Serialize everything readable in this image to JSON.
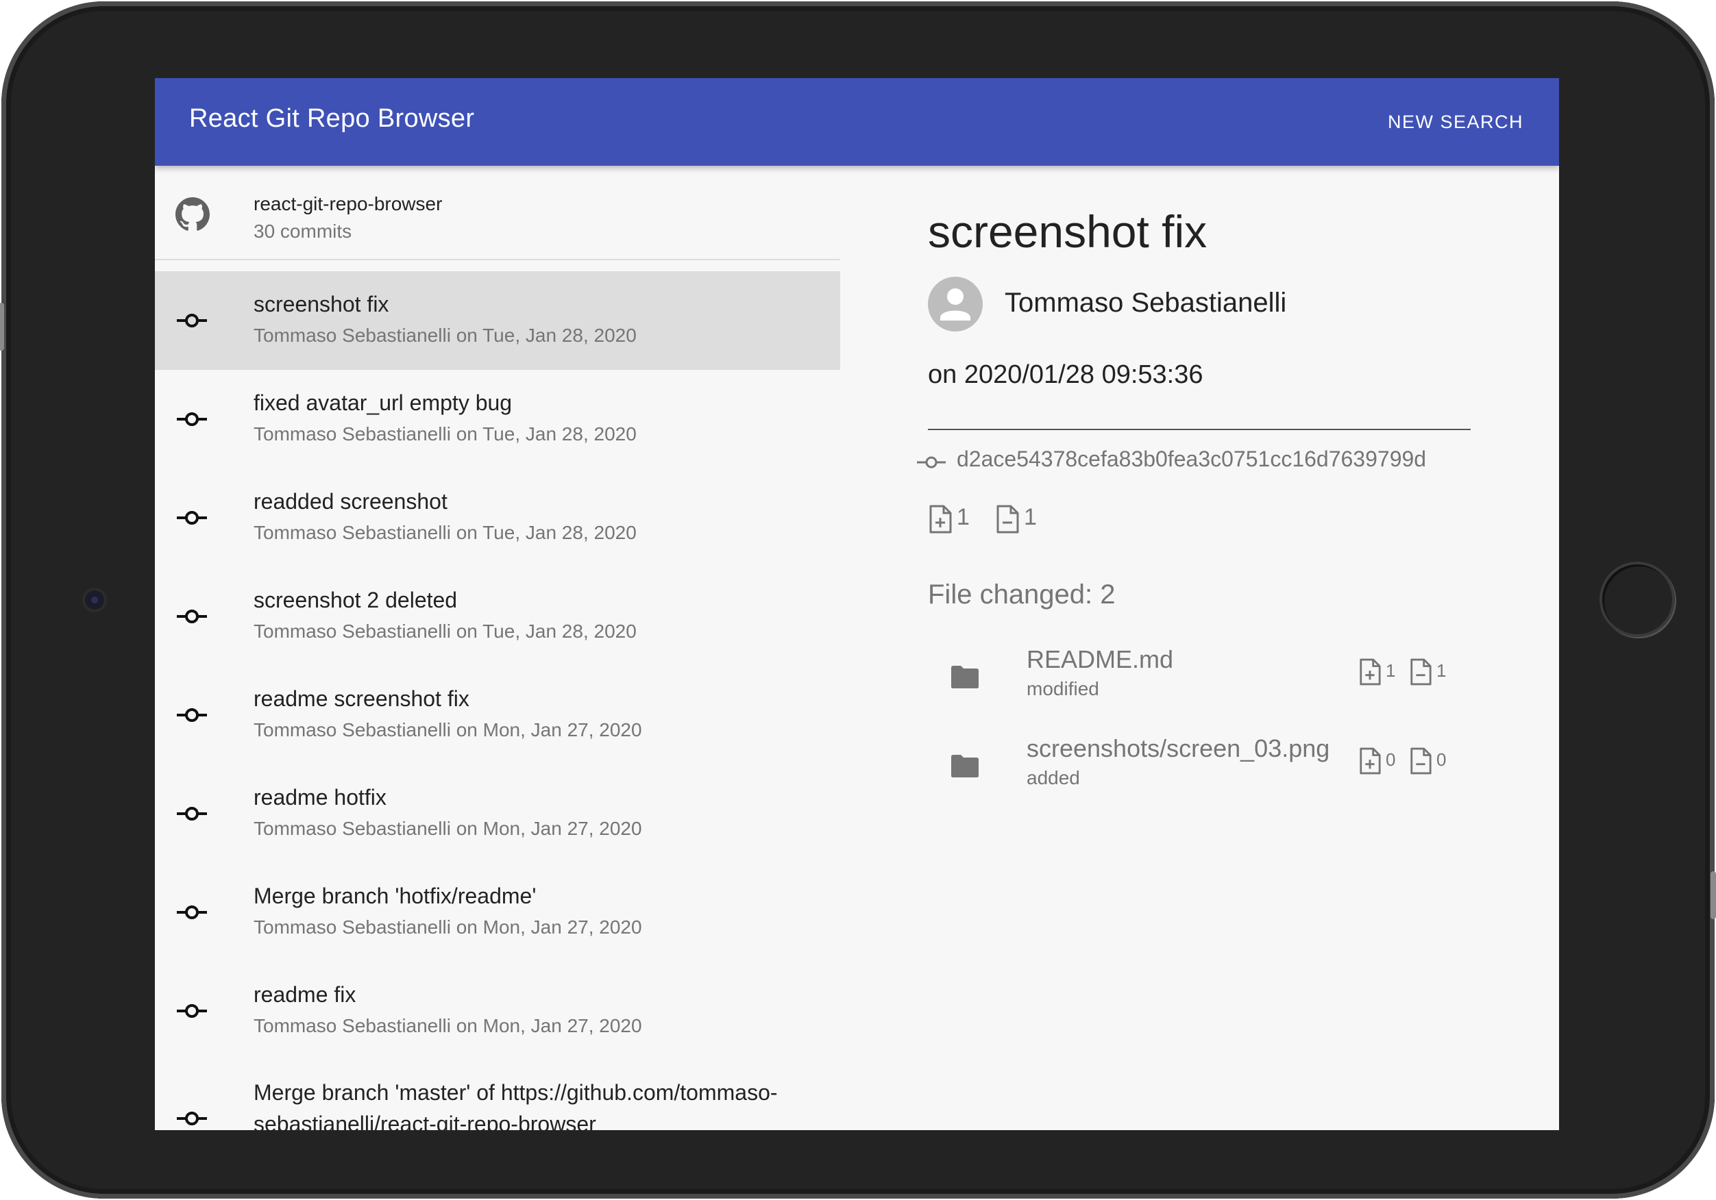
{
  "app": {
    "title": "React Git Repo Browser",
    "new_search_label": "NEW SEARCH"
  },
  "repo": {
    "name": "react-git-repo-browser",
    "commit_count": "30 commits",
    "icon": "github-icon"
  },
  "commits": [
    {
      "message": "screenshot fix",
      "meta": "Tommaso Sebastianelli on Tue, Jan 28, 2020",
      "selected": true
    },
    {
      "message": "fixed avatar_url empty bug",
      "meta": "Tommaso Sebastianelli on Tue, Jan 28, 2020"
    },
    {
      "message": "readded screenshot",
      "meta": "Tommaso Sebastianelli on Tue, Jan 28, 2020"
    },
    {
      "message": "screenshot 2 deleted",
      "meta": "Tommaso Sebastianelli on Tue, Jan 28, 2020"
    },
    {
      "message": "readme screenshot fix",
      "meta": "Tommaso Sebastianelli on Mon, Jan 27, 2020"
    },
    {
      "message": "readme hotfix",
      "meta": "Tommaso Sebastianelli on Mon, Jan 27, 2020"
    },
    {
      "message": "Merge branch 'hotfix/readme'",
      "meta": "Tommaso Sebastianelli on Mon, Jan 27, 2020"
    },
    {
      "message": "readme fix",
      "meta": "Tommaso Sebastianelli on Mon, Jan 27, 2020"
    },
    {
      "message": "Merge branch 'master' of https://github.com/tommaso-sebastianelli/react-git-repo-browser",
      "meta": ""
    }
  ],
  "detail": {
    "title": "screenshot fix",
    "author": "Tommaso Sebastianelli",
    "date": "on 2020/01/28 09:53:36",
    "sha": "d2ace54378cefa83b0fea3c0751cc16d7639799d",
    "additions": "1",
    "deletions": "1",
    "files_changed_label": "File changed: 2",
    "files": [
      {
        "name": "README.md",
        "status": "modified",
        "additions": "1",
        "deletions": "1"
      },
      {
        "name": "screenshots/screen_03.png",
        "status": "added",
        "additions": "0",
        "deletions": "0"
      }
    ]
  },
  "colors": {
    "appbar": "#3f51b5",
    "selected_row": "#dddddd",
    "screen_bg": "#f7f7f7"
  }
}
